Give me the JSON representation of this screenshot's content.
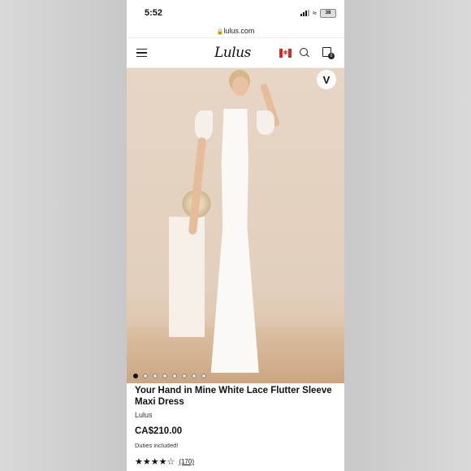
{
  "status_bar": {
    "time": "5:52",
    "battery": "38"
  },
  "browser": {
    "url": "lulus.com"
  },
  "nav": {
    "logo": "Lulus",
    "flag_icon": "canada-flag-icon",
    "bag_count": "0"
  },
  "wishlist": {
    "icon": "V"
  },
  "gallery": {
    "dots": 8,
    "active_index": 0
  },
  "product": {
    "title": "Your Hand in Mine White Lace Flutter Sleeve Maxi Dress",
    "brand": "Lulus",
    "price": "CA$210.00",
    "duties_note": "Duties included!",
    "rating_stars": "★★★★☆",
    "rating_value": 4.5,
    "review_count": "(170)"
  }
}
